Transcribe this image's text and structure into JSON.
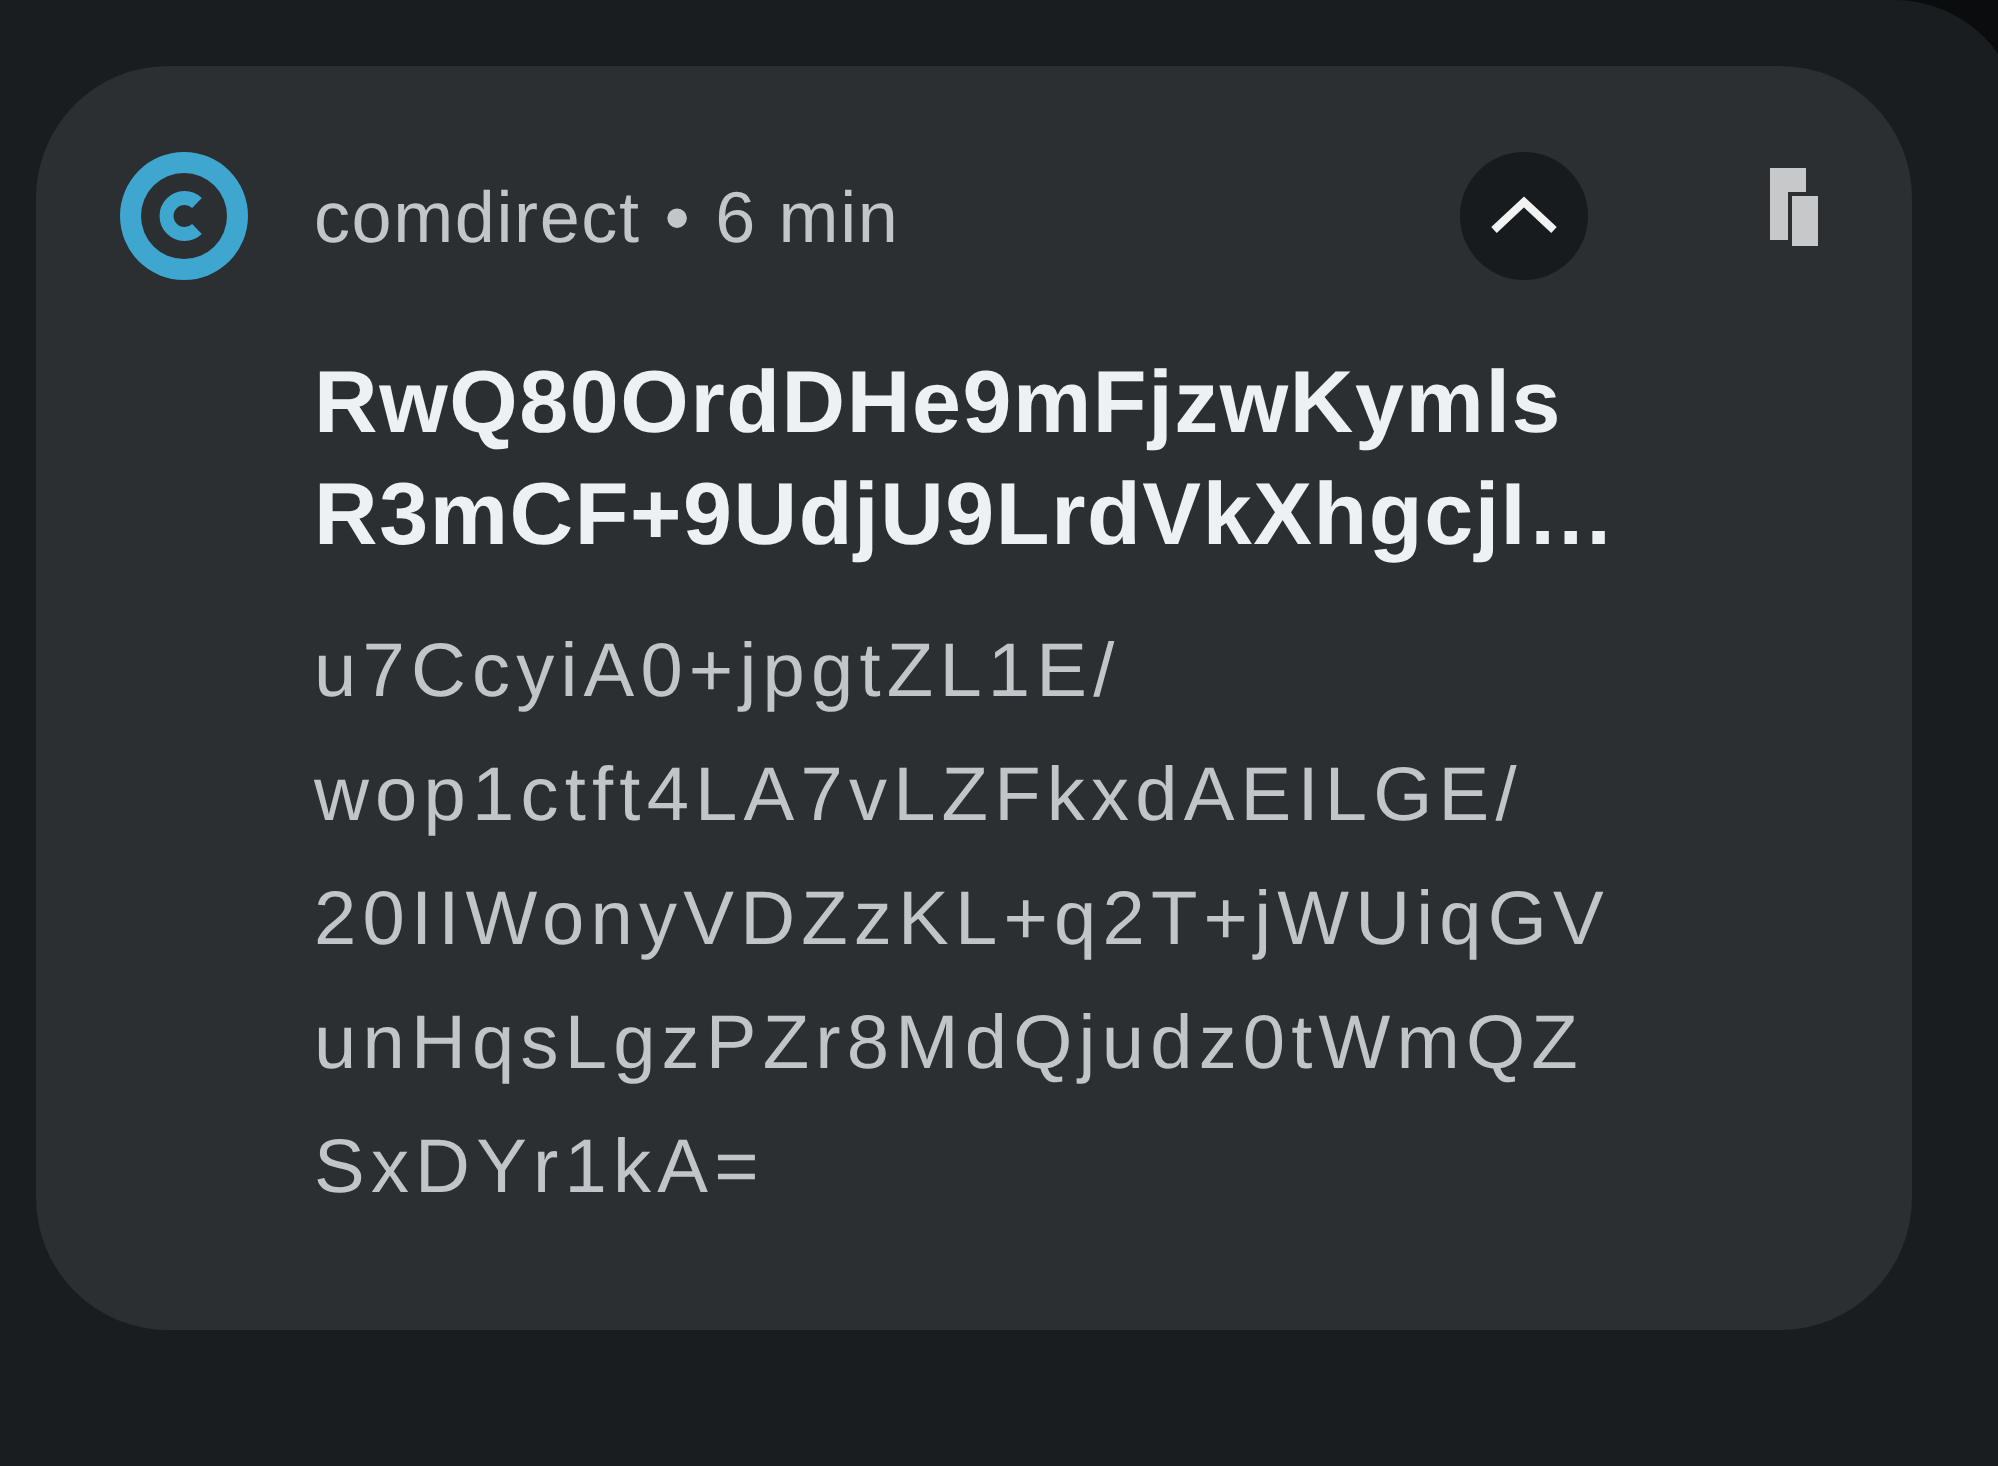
{
  "notification": {
    "app_name": "comdirect",
    "separator": "•",
    "time": "6 min",
    "expanded": true,
    "title_lines": [
      "RwQ80OrdDHe9mFjzwKymls",
      "R3mCF+9UdjU9LrdVkXhgcjI…"
    ],
    "body_lines": [
      "u7CcyiA0+jpgtZL1E/",
      "wop1ctft4LA7vLZFkxdAEILGE/",
      "20IIWonyVDZzKL+q2T+jWUiqGV",
      "unHqsLgzPZr8MdQjudz0tWmQZ",
      "SxDYr1kA="
    ]
  }
}
